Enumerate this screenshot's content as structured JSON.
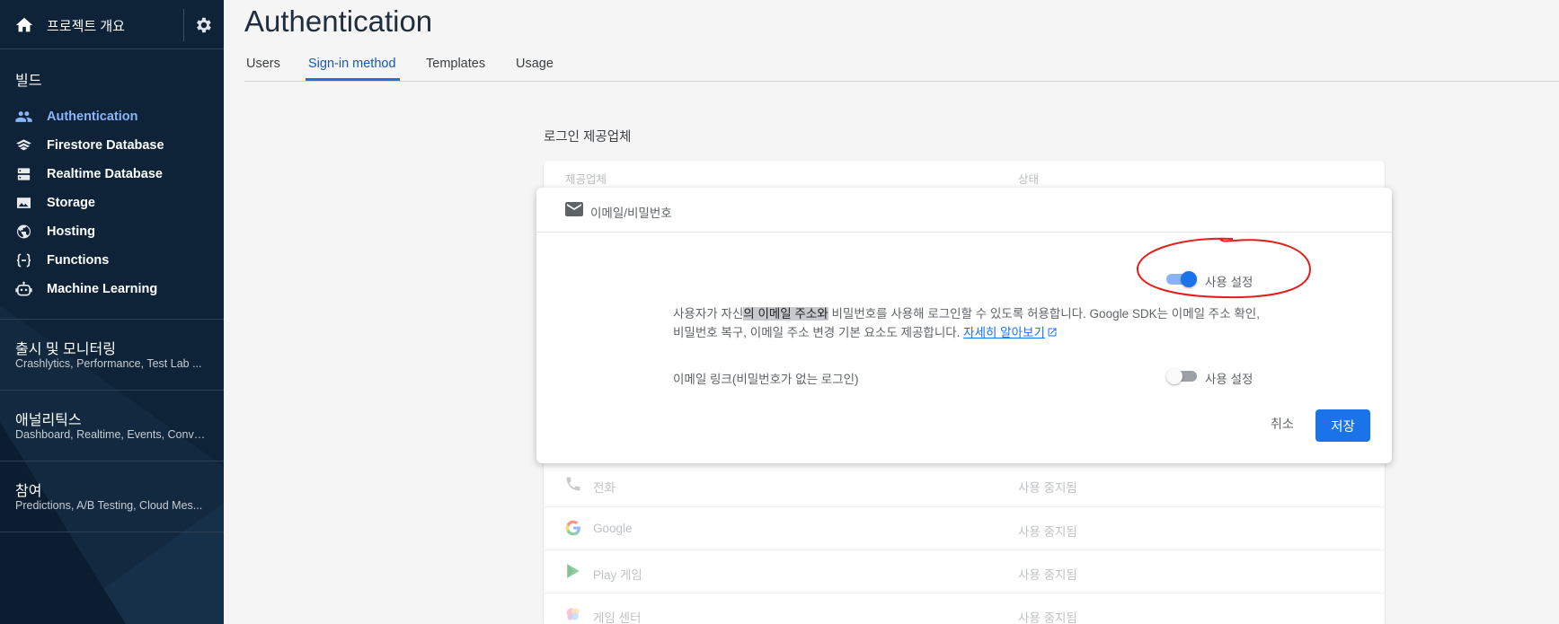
{
  "sidebar": {
    "project_title": "프로젝트 개요",
    "build_section": "빌드",
    "items": [
      {
        "label": "Authentication",
        "icon": "people-icon",
        "active": true
      },
      {
        "label": "Firestore Database",
        "icon": "firestore-icon"
      },
      {
        "label": "Realtime Database",
        "icon": "database-icon"
      },
      {
        "label": "Storage",
        "icon": "image-icon"
      },
      {
        "label": "Hosting",
        "icon": "globe-icon"
      },
      {
        "label": "Functions",
        "icon": "functions-icon"
      },
      {
        "label": "Machine Learning",
        "icon": "robot-icon"
      }
    ],
    "groups": [
      {
        "title": "출시 및 모니터링",
        "subtitle": "Crashlytics, Performance, Test Lab ..."
      },
      {
        "title": "애널리틱스",
        "subtitle": "Dashboard, Realtime, Events, Conve..."
      },
      {
        "title": "참여",
        "subtitle": "Predictions, A/B Testing, Cloud Mes..."
      }
    ]
  },
  "header": {
    "title": "Authentication",
    "tabs": [
      {
        "label": "Users"
      },
      {
        "label": "Sign-in method",
        "active": true
      },
      {
        "label": "Templates"
      },
      {
        "label": "Usage"
      }
    ]
  },
  "providers": {
    "heading": "로그인 제공업체",
    "columns": {
      "provider": "제공업체",
      "status": "상태"
    },
    "rows": [
      {
        "name": "전화",
        "status": "사용 중지됨",
        "icon": "phone-icon"
      },
      {
        "name": "Google",
        "status": "사용 중지됨",
        "icon": "google-icon"
      },
      {
        "name": "Play 게임",
        "status": "사용 중지됨",
        "icon": "play-games-icon"
      },
      {
        "name": "게임 센터",
        "status": "사용 중지됨",
        "icon": "game-center-icon"
      }
    ]
  },
  "modal": {
    "title": "이메일/비밀번호",
    "enable_label": "사용 설정",
    "enable_on": true,
    "desc_part1": "사용자가 자신",
    "desc_highlight": "의 이메일 주소와",
    "desc_part2": " 비밀번호를 사용해 로그인할 수 있도록 허용합니다. Google SDK는 이메일 주소 확인, 비밀번호 복구, 이메일 주소 변경 기본 요소도 제공합니다. ",
    "learn_more": "자세히 알아보기",
    "email_link_label": "이메일 링크(비밀번호가 없는 로그인)",
    "email_link_enable_label": "사용 설정",
    "email_link_on": false,
    "cancel_label": "취소",
    "save_label": "저장"
  },
  "colors": {
    "sidebar_bg": "#0e2338",
    "accent": "#1a73e8",
    "annotation": "#e0201c"
  }
}
